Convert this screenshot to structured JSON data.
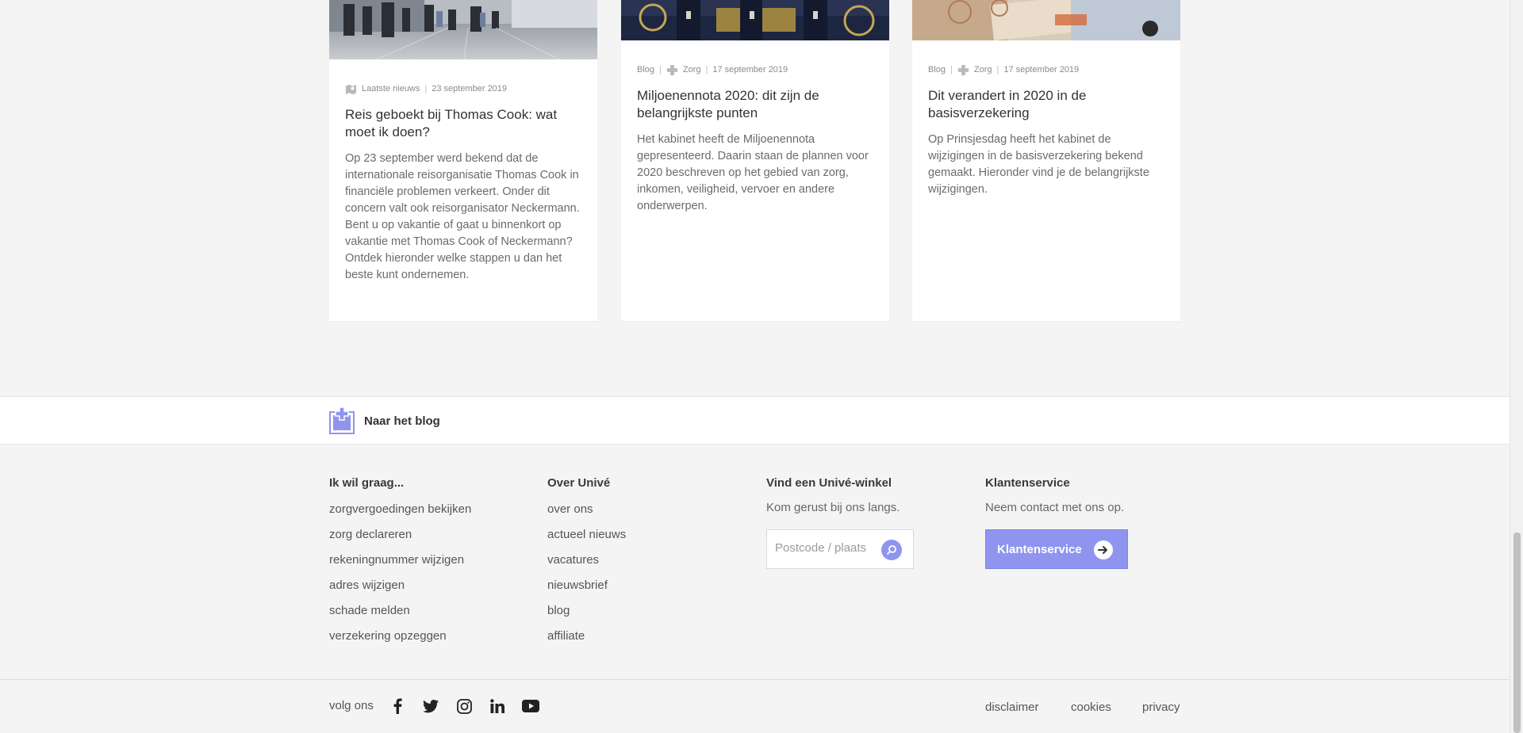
{
  "cards": [
    {
      "category": "Laatste nieuws",
      "date": "23 september 2019",
      "title": "Reis geboekt bij Thomas Cook: wat moet ik doen?",
      "text": "Op 23 september werd bekend dat de internationale reisorganisatie Thomas Cook in financiële problemen verkeert. Onder dit concern valt ook reisorganisator Neckermann. Bent u op vakantie of gaat u binnenkort op vakantie met Thomas Cook of Neckermann? Ontdek hieronder welke stappen u dan het beste kunt ondernemen.",
      "image": "airport-travelers-photo"
    },
    {
      "type": "Blog",
      "category": "Zorg",
      "date": "17 september 2019",
      "title": "Miljoenennota 2020: dit zijn de belangrijkste punten",
      "text": "Het kabinet heeft de Miljoenennota gepresenteerd. Daarin staan de plannen voor 2020 beschreven op het gebied van zorg, inkomen, veiligheid, vervoer en andere onderwerpen.",
      "image": "royal-carriage-photo"
    },
    {
      "type": "Blog",
      "category": "Zorg",
      "date": "17 september 2019",
      "title": "Dit verandert in 2020 in de basisverzekering",
      "text": "Op Prinsjesdag heeft het kabinet de wijzigingen in de basisverzekering bekend gemaakt. Hieronder vind je de belangrijkste wijzigingen.",
      "image": "euro-banknotes-photo"
    }
  ],
  "blog_link": {
    "label": "Naar het blog",
    "icon": "blog-plus-icon"
  },
  "footer": {
    "col1": {
      "title": "Ik wil graag...",
      "links": [
        "zorgvergoedingen bekijken",
        "zorg declareren",
        "rekeningnummer wijzigen",
        "adres wijzigen",
        "schade melden",
        "verzekering opzeggen"
      ]
    },
    "col2": {
      "title": "Over Univé",
      "links": [
        "over ons",
        "actueel nieuws",
        "vacatures",
        "nieuwsbrief",
        "blog",
        "affiliate"
      ]
    },
    "col3": {
      "title": "Vind een Univé-winkel",
      "text": "Kom gerust bij ons langs.",
      "placeholder": "Postcode / plaats"
    },
    "col4": {
      "title": "Klantenservice",
      "text": "Neem contact met ons op.",
      "button": "Klantenservice"
    },
    "follow": "volg ons",
    "social": [
      "facebook-icon",
      "twitter-icon",
      "instagram-icon",
      "linkedin-icon",
      "youtube-icon"
    ],
    "legal": [
      "disclaimer",
      "cookies",
      "privacy"
    ]
  },
  "colors": {
    "accent": "#8f95ef",
    "background": "#f4f4f4"
  }
}
